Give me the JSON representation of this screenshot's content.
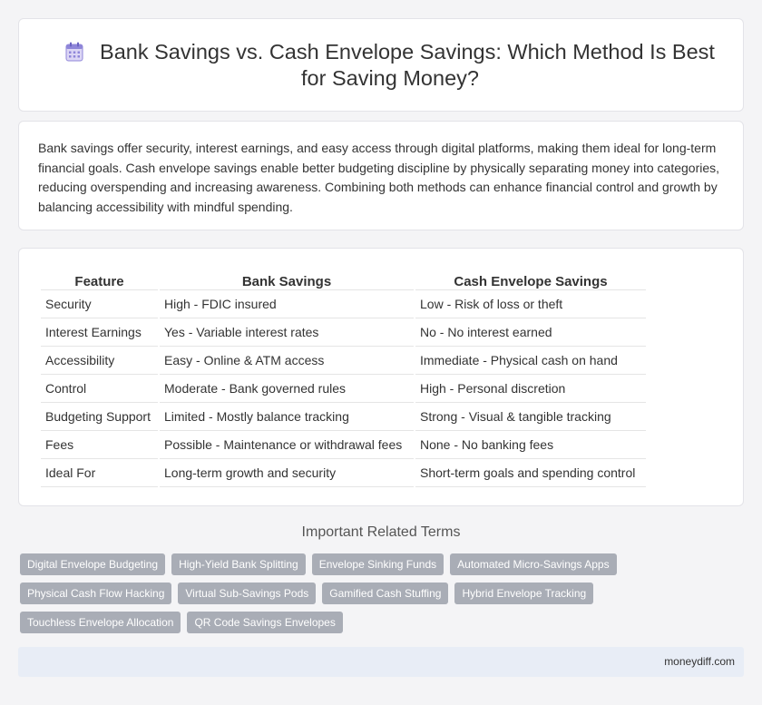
{
  "header": {
    "title": "Bank Savings vs. Cash Envelope Savings: Which Method Is Best for Saving Money?",
    "icon": "calendar-icon"
  },
  "summary": "Bank savings offer security, interest earnings, and easy access through digital platforms, making them ideal for long-term financial goals. Cash envelope savings enable better budgeting discipline by physically separating money into categories, reducing overspending and increasing awareness. Combining both methods can enhance financial control and growth by balancing accessibility with mindful spending.",
  "table": {
    "headers": [
      "Feature",
      "Bank Savings",
      "Cash Envelope Savings"
    ],
    "rows": [
      [
        "Security",
        "High - FDIC insured",
        "Low - Risk of loss or theft"
      ],
      [
        "Interest Earnings",
        "Yes - Variable interest rates",
        "No - No interest earned"
      ],
      [
        "Accessibility",
        "Easy - Online & ATM access",
        "Immediate - Physical cash on hand"
      ],
      [
        "Control",
        "Moderate - Bank governed rules",
        "High - Personal discretion"
      ],
      [
        "Budgeting Support",
        "Limited - Mostly balance tracking",
        "Strong - Visual & tangible tracking"
      ],
      [
        "Fees",
        "Possible - Maintenance or withdrawal fees",
        "None - No banking fees"
      ],
      [
        "Ideal For",
        "Long-term growth and security",
        "Short-term goals and spending control"
      ]
    ]
  },
  "related": {
    "title": "Important Related Terms",
    "tags": [
      "Digital Envelope Budgeting",
      "High-Yield Bank Splitting",
      "Envelope Sinking Funds",
      "Automated Micro-Savings Apps",
      "Physical Cash Flow Hacking",
      "Virtual Sub-Savings Pods",
      "Gamified Cash Stuffing",
      "Hybrid Envelope Tracking",
      "Touchless Envelope Allocation",
      "QR Code Savings Envelopes"
    ]
  },
  "footer": {
    "site": "moneydiff.com"
  }
}
